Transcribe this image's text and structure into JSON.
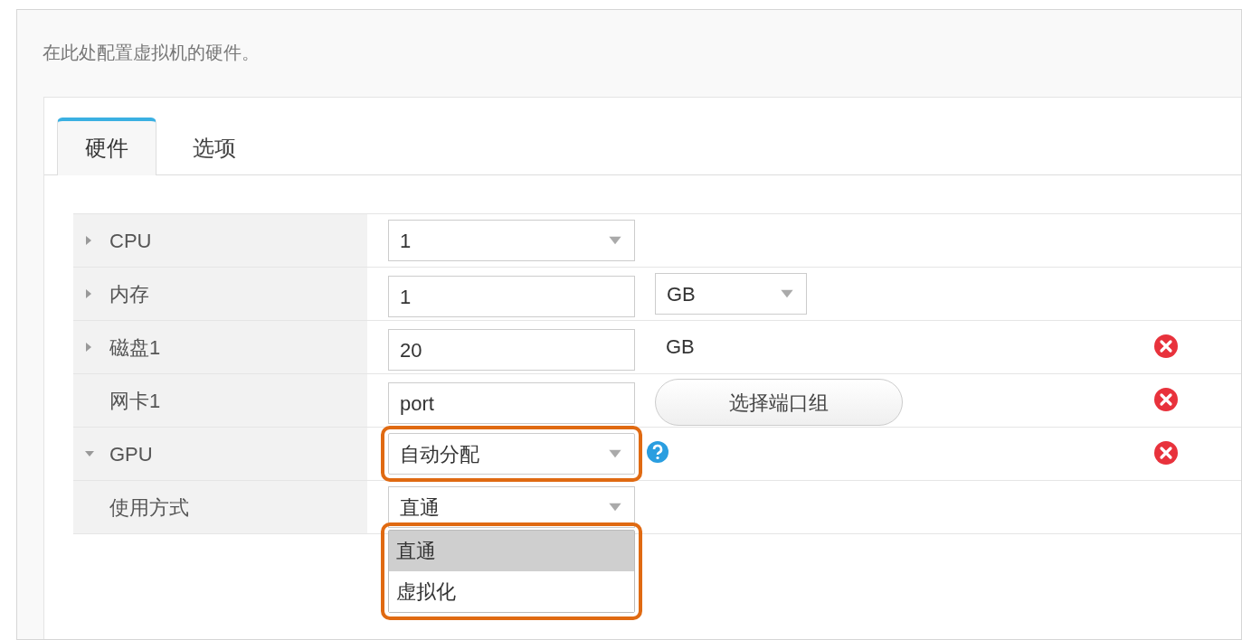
{
  "description": "在此处配置虚拟机的硬件。",
  "tabs": [
    {
      "label": "硬件",
      "selected": true
    },
    {
      "label": "选项",
      "selected": false
    }
  ],
  "rows": [
    {
      "label": "CPU",
      "expanded": false,
      "deletable": false,
      "controls": [
        {
          "kind": "select",
          "value": "1",
          "highlighted": false
        }
      ]
    },
    {
      "label": "内存",
      "expanded": false,
      "deletable": false,
      "controls": [
        {
          "kind": "input",
          "value": "1"
        },
        {
          "kind": "select",
          "value": "GB",
          "highlighted": false
        }
      ]
    },
    {
      "label": "磁盘1",
      "expanded": false,
      "deletable": true,
      "controls": [
        {
          "kind": "input",
          "value": "20"
        },
        {
          "kind": "text",
          "value": "GB"
        }
      ]
    },
    {
      "label": "网卡1",
      "deletable": true,
      "controls": [
        {
          "kind": "input",
          "value": "port"
        },
        {
          "kind": "button",
          "value": "选择端口组"
        }
      ]
    },
    {
      "label": "GPU",
      "expanded": true,
      "deletable": true,
      "controls": [
        {
          "kind": "select",
          "value": "自动分配",
          "highlighted": true
        },
        {
          "kind": "help"
        }
      ]
    },
    {
      "label": "使用方式",
      "deletable": false,
      "controls": [
        {
          "kind": "select",
          "value": "直通",
          "highlighted": false,
          "dropdown": {
            "highlighted": true,
            "options": [
              {
                "label": "直通",
                "selected": true
              },
              {
                "label": "虚拟化",
                "selected": false
              }
            ]
          }
        }
      ]
    }
  ]
}
